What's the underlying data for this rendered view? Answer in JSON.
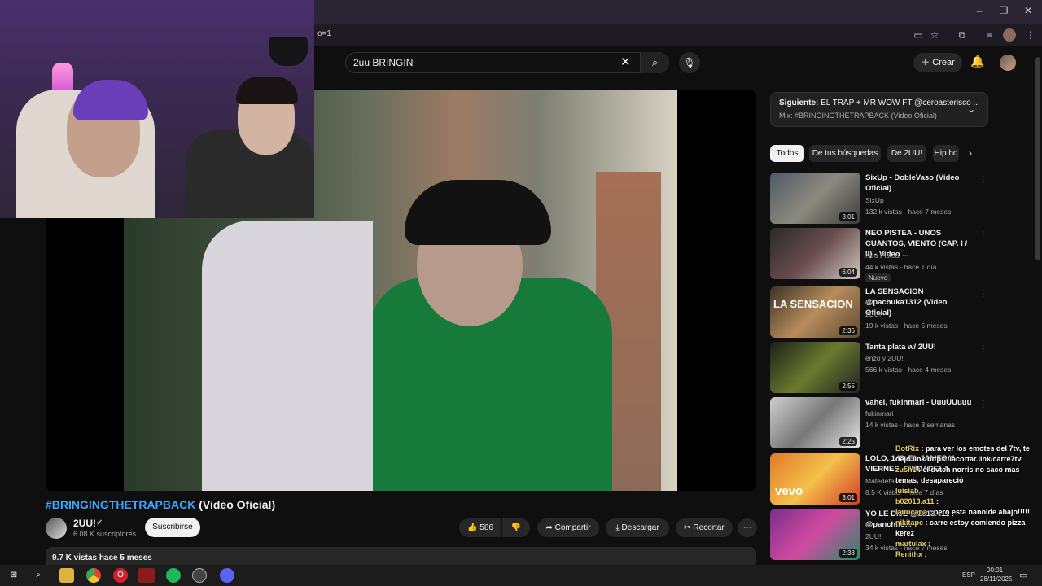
{
  "browser": {
    "url_fragment": "o=1",
    "window_controls": {
      "minimize": "–",
      "maximize": "❐",
      "close": "✕"
    }
  },
  "youtube": {
    "search_query": "2uu BRINGIN",
    "create_label": "Crear"
  },
  "video": {
    "title_hashtag": "#BRINGINGTHETRAPBACK",
    "title_rest": " (Video Oficial)",
    "channel": "2UU!",
    "subscribers": "6.08 K suscriptores",
    "subscribe_label": "Suscribirse",
    "likes": "586",
    "share_label": "Compartir",
    "download_label": "Descargar",
    "clip_label": "Recortar",
    "views_date": "9.7 K vistas  hace 5 meses"
  },
  "next_up": {
    "label_bold": "Siguiente:",
    "label_rest": " EL TRAP + MR WOW FT @ceroasterisco ...",
    "sub": "Mix: #BRINGINGTHETRAPBACK (Video Oficial)"
  },
  "chips": [
    "Todos",
    "De tus búsquedas",
    "De 2UU!",
    "Hip ho"
  ],
  "recommendations": [
    {
      "title": "SixUp - DobleVaso (Video Oficial)",
      "channel": "SixUp",
      "meta": "132 k vistas · hace 7 meses",
      "duration": "3:01",
      "badge": ""
    },
    {
      "title": "NEO PISTEA - UNOS CUANTOS, VIENTO (CAP. I / II) - Video ...",
      "channel": "Neo Pistea",
      "meta": "44 k vistas · hace 1 día",
      "duration": "6:04",
      "badge": "Nuevo"
    },
    {
      "title": "LA SENSACION @pachuka1312 (Video Oficial)",
      "channel": "2UU!",
      "meta": "19 k vistas · hace 5 meses",
      "duration": "2:36",
      "badge": ""
    },
    {
      "title": "Tanta plata w/ 2UU!",
      "channel": "enzo y 2UU!",
      "meta": "566 k vistas · hace 4 meses",
      "duration": "2:55",
      "badge": ""
    },
    {
      "title": "vahel, fukinmari - UuuUUuuu",
      "channel": "fukinmari",
      "meta": "14 k vistas · hace 3 semanas",
      "duration": "2:25",
      "badge": ""
    },
    {
      "title": "LOLO, 143, EL JAMES V VIERNES, CIUDADELA",
      "channel": "Matedefas",
      "meta": "8.5 K vistas · hace 7 días",
      "duration": "3:01",
      "badge": ""
    },
    {
      "title": "YO LE DIJE @2013.411 : @panchito...",
      "channel": "2UU!",
      "meta": "34 k vistas · hace 7 meses",
      "duration": "2:38",
      "badge": ""
    }
  ],
  "thumb_texts": {
    "sensacion": "LA SENSACION",
    "vevo": "vevo"
  },
  "chat": [
    {
      "user": "BotRix",
      "msg": " : para ver los emotes del 7tv, te dejo link https://acortar.link/carre7tv"
    },
    {
      "user": "zush1",
      "msg": " : el dvtch norris no saco mas temas, desapareció"
    },
    {
      "user": "luisiab",
      "msg": " :"
    },
    {
      "user": "b02013.a11",
      "msg": " :"
    },
    {
      "user": "lauucapa",
      "msg": " : pero esta nanolde abajo!!!!!"
    },
    {
      "user": "nikitapc",
      "msg": " : carre estoy comiendo pizza kerez"
    },
    {
      "user": "martulax",
      "msg": " :"
    },
    {
      "user": "Renithx",
      "msg": " :"
    }
  ],
  "taskbar": {
    "lang": "ESP",
    "time": "00:01",
    "date": "28/11/2025"
  },
  "colors": {
    "bg": "#0f0f0f",
    "link": "#3ea6ff",
    "chip_active": "#f1f1f1",
    "panel": "#272727"
  }
}
